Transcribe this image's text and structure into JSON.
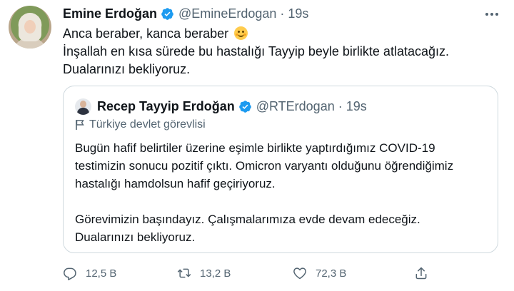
{
  "author": {
    "name": "Emine Erdoğan",
    "handle": "@EmineErdogan",
    "separator": "·",
    "time": "19s"
  },
  "tweet": {
    "line1": "Anca beraber, kanca beraber",
    "line2": "İnşallah en kısa sürede bu hastalığı Tayyip beyle birlikte atlatacağız.",
    "line3": "Dualarınızı bekliyoruz."
  },
  "quoted": {
    "name": "Recep Tayyip Erdoğan",
    "handle": "@RTErdogan",
    "separator": "·",
    "time": "19s",
    "label": "Türkiye devlet görevlisi",
    "lines": [
      "Bugün hafif belirtiler üzerine eşimle birlikte yaptırdığımız COVID-19",
      "testimizin sonucu pozitif çıktı. Omicron varyantı olduğunu öğrendiğimiz",
      "hastalığı hamdolsun hafif geçiriyoruz."
    ],
    "lines2": [
      "Görevimizin başındayız. Çalışmalarımıza evde devam edeceğiz.",
      "Dualarınızı bekliyoruz."
    ]
  },
  "actions": {
    "reply_count": "12,5 B",
    "retweet_count": "13,2 B",
    "like_count": "72,3 B"
  },
  "icons": {
    "verified": "verified-badge-icon",
    "more": "more-icon",
    "flag": "flag-icon",
    "reply": "reply-icon",
    "retweet": "retweet-icon",
    "like": "heart-icon",
    "share": "share-icon",
    "emoji": "smiling-face-emoji"
  },
  "colors": {
    "verified": "#1d9bf0",
    "secondary_text": "#536471",
    "border": "#cfd9de"
  }
}
